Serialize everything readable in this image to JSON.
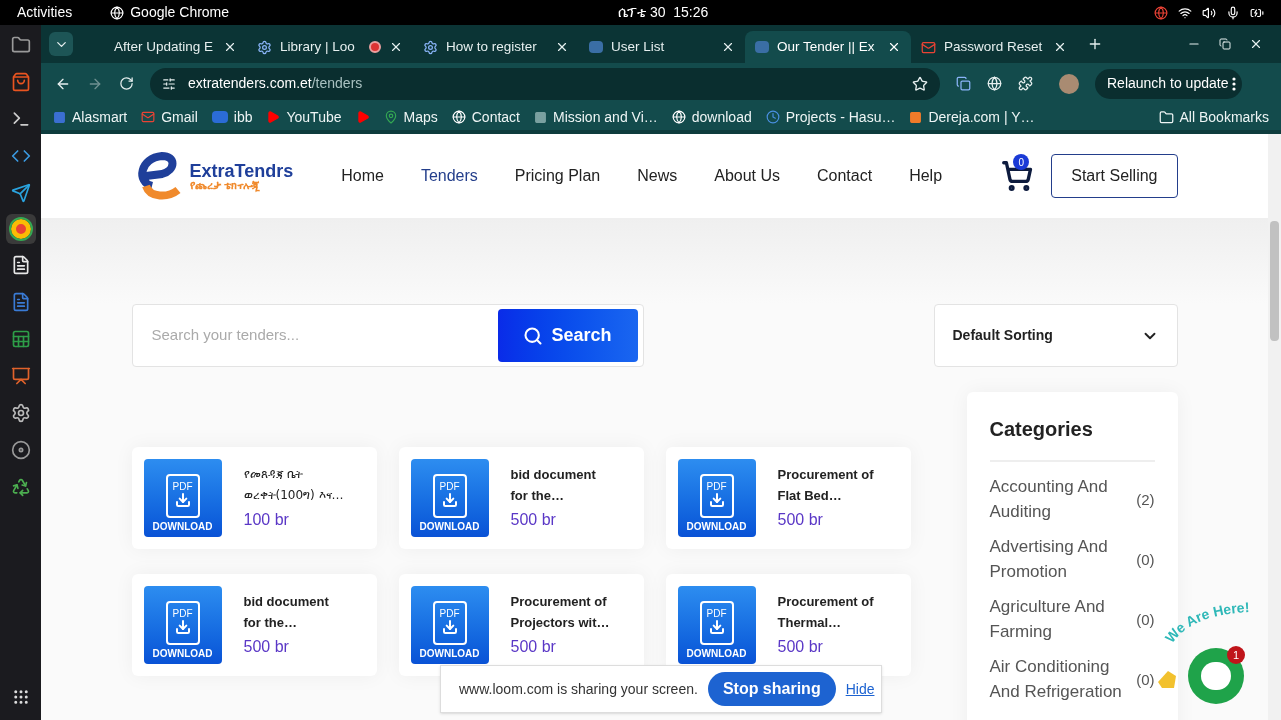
{
  "system_bar": {
    "activities": "Activities",
    "app": "Google Chrome",
    "clock": "ሴፕቴ 30  15:26"
  },
  "browser": {
    "tabs": [
      {
        "title": "After Updating E",
        "selected": false
      },
      {
        "title": "Library | Loo",
        "selected": false
      },
      {
        "title": "How to register",
        "selected": false
      },
      {
        "title": "User List",
        "selected": false
      },
      {
        "title": "Our Tender || Ex",
        "selected": true
      },
      {
        "title": "Password Reset",
        "selected": false
      }
    ],
    "address": {
      "domain": "extratenders.com.et",
      "path": "/tenders"
    },
    "relaunch": "Relaunch to update",
    "bookmarks": [
      {
        "label": "Alasmart"
      },
      {
        "label": "Gmail"
      },
      {
        "label": "ibb"
      },
      {
        "label": "YouTube"
      },
      {
        "label": "Maps"
      },
      {
        "label": "Contact"
      },
      {
        "label": "Mission and Vi…"
      },
      {
        "label": "download"
      },
      {
        "label": "Projects - Hasu…"
      },
      {
        "label": "Dereja.com | Y…"
      }
    ],
    "all_bookmarks": "All Bookmarks"
  },
  "page": {
    "logo": {
      "name": "ExtraTendrs",
      "tagline": "የጨረታ ቴክኖሎጂ"
    },
    "nav": [
      {
        "label": "Home",
        "selected": false
      },
      {
        "label": "Tenders",
        "selected": true
      },
      {
        "label": "Pricing Plan",
        "selected": false
      },
      {
        "label": "News",
        "selected": false
      },
      {
        "label": "About Us",
        "selected": false
      },
      {
        "label": "Contact",
        "selected": false
      },
      {
        "label": "Help",
        "selected": false
      }
    ],
    "cart_count": "0",
    "start_selling": "Start Selling",
    "search": {
      "placeholder": "Search your tenders...",
      "button": "Search"
    },
    "sorting": "Default Sorting",
    "tenders": [
      {
        "title": "የመጸዳጃ ቤት ወረቀት(100ግ) እና…",
        "price": "100 br",
        "pdf": "PDF",
        "download": "DOWNLOAD",
        "bold": false
      },
      {
        "title": "bid document for the…",
        "price": "500 br",
        "pdf": "PDF",
        "download": "DOWNLOAD",
        "bold": true
      },
      {
        "title": "Procurement of Flat Bed…",
        "price": "500 br",
        "pdf": "PDF",
        "download": "DOWNLOAD",
        "bold": true
      },
      {
        "title": "bid document for the…",
        "price": "500 br",
        "pdf": "PDF",
        "download": "DOWNLOAD",
        "bold": true
      },
      {
        "title": "Procurement of Projectors wit…",
        "price": "500 br",
        "pdf": "PDF",
        "download": "DOWNLOAD",
        "bold": true
      },
      {
        "title": "Procurement of Thermal…",
        "price": "500 br",
        "pdf": "PDF",
        "download": "DOWNLOAD",
        "bold": true
      }
    ],
    "categories": {
      "title": "Categories",
      "items": [
        {
          "name": "Accounting And Auditing",
          "count": "(2)"
        },
        {
          "name": "Advertising And Promotion",
          "count": "(0)"
        },
        {
          "name": "Agriculture And Farming",
          "count": "(0)"
        },
        {
          "name": "Air Conditioning And Refrigeration",
          "count": "(0)"
        }
      ]
    }
  },
  "loom": {
    "message": "www.loom.com is sharing your screen.",
    "button": "Stop sharing",
    "hide": "Hide"
  },
  "chat": {
    "caption": "We Are Here!",
    "badge": "1"
  }
}
